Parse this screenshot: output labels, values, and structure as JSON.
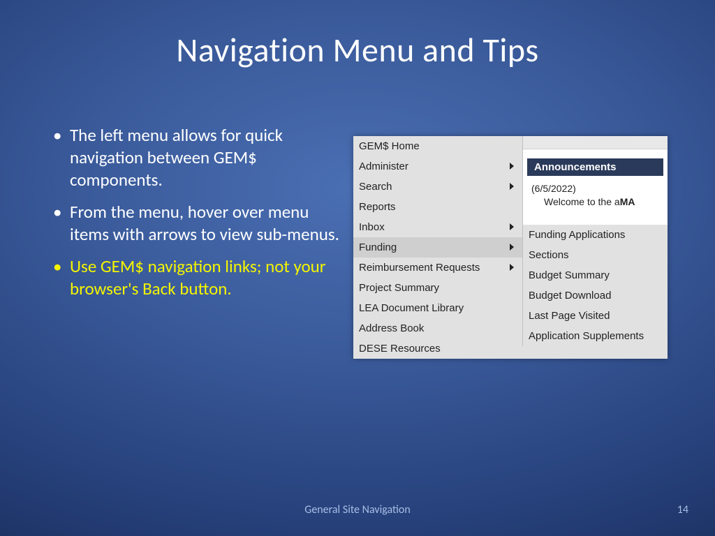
{
  "title": "Navigation Menu and Tips",
  "bullets": [
    {
      "text": "The left menu allows for quick navigation between GEM$ components.",
      "highlight": false
    },
    {
      "text": "From the menu, hover over menu items with arrows to view sub-menus.",
      "highlight": false
    },
    {
      "text": "Use GEM$ navigation links; not your browser's Back button.",
      "highlight": true
    }
  ],
  "menu": {
    "left": [
      {
        "label": "GEM$ Home",
        "arrow": false,
        "selected": false
      },
      {
        "label": "Administer",
        "arrow": true,
        "selected": false
      },
      {
        "label": "Search",
        "arrow": true,
        "selected": false
      },
      {
        "label": "Reports",
        "arrow": false,
        "selected": false
      },
      {
        "label": "Inbox",
        "arrow": true,
        "selected": false
      },
      {
        "label": "Funding",
        "arrow": true,
        "selected": true
      },
      {
        "label": "Reimbursement Requests",
        "arrow": true,
        "selected": false
      },
      {
        "label": "Project Summary",
        "arrow": false,
        "selected": false
      },
      {
        "label": "LEA Document Library",
        "arrow": false,
        "selected": false
      },
      {
        "label": "Address Book",
        "arrow": false,
        "selected": false
      },
      {
        "label": "DESE Resources",
        "arrow": false,
        "selected": false
      }
    ],
    "announcements": {
      "header": "Announcements",
      "date": "(6/5/2022)",
      "body_prefix": "Welcome to the a",
      "body_bold": "MA"
    },
    "submenu": [
      "Funding Applications",
      "Sections",
      "Budget Summary",
      "Budget Download",
      "Last Page Visited",
      "Application Supplements"
    ]
  },
  "footer": "General Site Navigation",
  "page_number": "14"
}
